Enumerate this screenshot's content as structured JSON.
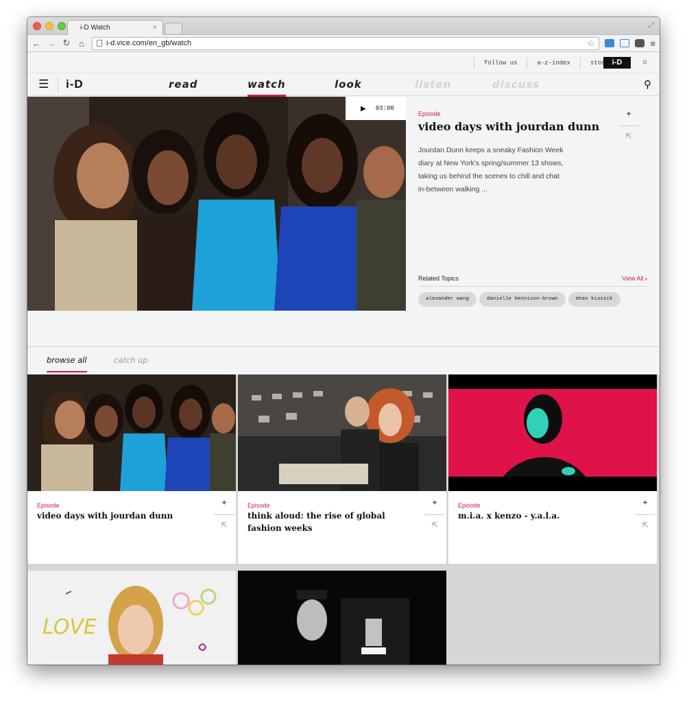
{
  "browser": {
    "tab_title": "i-D Watch",
    "tab_close": "×",
    "url": "i-d.vice.com/en_gb/watch"
  },
  "utility": {
    "links": [
      "follow us",
      "a-z-index",
      "store"
    ],
    "logo": "i-D"
  },
  "nav": {
    "brand": "i-D",
    "items": [
      {
        "label": "read",
        "state": "normal"
      },
      {
        "label": "watch",
        "state": "active"
      },
      {
        "label": "look",
        "state": "normal"
      },
      {
        "label": "listen",
        "state": "faded"
      },
      {
        "label": "discuss",
        "state": "faded"
      }
    ]
  },
  "hero": {
    "duration": "03:00",
    "kicker": "Episode",
    "title": "video days with jourdan dunn",
    "description": "Jourdan Dunn keeps a sneaky Fashion Week diary at New York's spring/summer 13 shows, taking us behind the scenes to chill and chat in-between walking ...",
    "related_label": "Related Topics",
    "view_all": "View All",
    "topics": [
      "alexander wang",
      "danielle bennison-brown",
      "dean kissick"
    ]
  },
  "browse": {
    "tabs": [
      "browse all",
      "catch up"
    ]
  },
  "cards": [
    {
      "kicker": "Episode",
      "title": "video days with jourdan dunn"
    },
    {
      "kicker": "Episode",
      "title": "think aloud: the rise of global fashion weeks"
    },
    {
      "kicker": "Episode",
      "title": "m.i.a. x kenzo - y.a.l.a."
    }
  ],
  "thumb_text": {
    "love": "LOVE"
  },
  "colors": {
    "accent": "#d11b4a",
    "page_bg": "#f3f4f6"
  }
}
